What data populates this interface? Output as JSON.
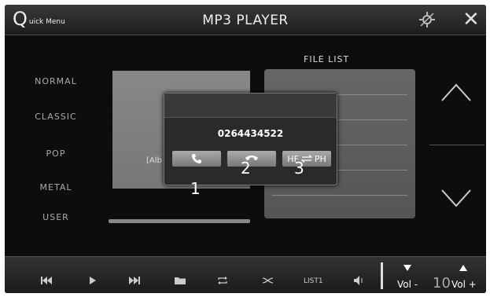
{
  "header": {
    "quick_menu_initial": "Q",
    "quick_menu_rest": "uick Menu",
    "title": "MP3 PLAYER",
    "settings_icon": "settings-icon",
    "close_icon": "close-icon"
  },
  "eq_presets": [
    "NORMAL",
    "CLASSIC",
    "POP",
    "METAL",
    "USER"
  ],
  "album": {
    "text": "[Alb"
  },
  "file_list": {
    "title": "FILE LIST"
  },
  "popup": {
    "phone_number": "0264434522",
    "buttons": [
      {
        "icon": "call-answer-icon"
      },
      {
        "icon": "call-hangup-icon"
      },
      {
        "label_left": "HF",
        "icon": "swap-icon",
        "label_right": "PH"
      }
    ],
    "callouts": [
      "1",
      "2",
      "3"
    ]
  },
  "controls": {
    "list_label": "LIST1",
    "vol_down_label": "Vol -",
    "vol_up_label": "Vol +",
    "volume_value": "10"
  },
  "colors": {
    "screen_bg": "#0d0d0d",
    "panel": "#777777",
    "text": "#eeeeee"
  }
}
